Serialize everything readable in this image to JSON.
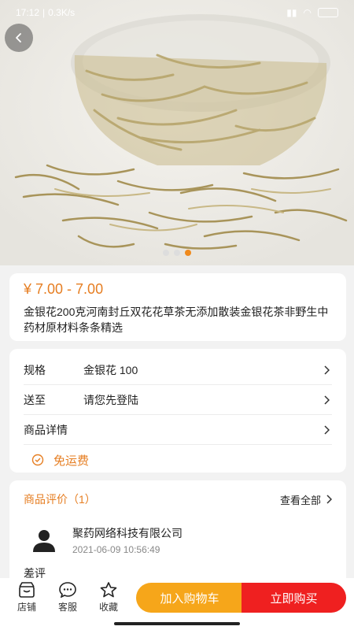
{
  "status_bar": {
    "time": "17:12",
    "speed": "0.3K/s"
  },
  "product": {
    "price": "¥ 7.00 - 7.00",
    "title": "金银花200克河南封丘双花花草茶无添加散装金银花茶非野生中药材原材料条条精选",
    "image_icon": "honeysuckle-photo"
  },
  "specs": [
    {
      "label": "规格",
      "value": "金银花 100"
    },
    {
      "label": "送至",
      "value": "请您先登陆"
    },
    {
      "label": "商品详情",
      "value": ""
    }
  ],
  "free_shipping": "免运费",
  "reviews": {
    "title": "商品评价（1）",
    "see_all": "查看全部",
    "reviewer_name": "聚药网络科技有限公司",
    "review_date": "2021-06-09 10:56:49",
    "rating": "差评"
  },
  "bottom_bar": {
    "store": "店铺",
    "service": "客服",
    "favorite": "收藏",
    "add_to_cart": "加入购物车",
    "buy_now": "立即购买"
  },
  "colors": {
    "accent": "#e67e22",
    "cart": "#f6a61a",
    "buy": "#ef2020"
  }
}
